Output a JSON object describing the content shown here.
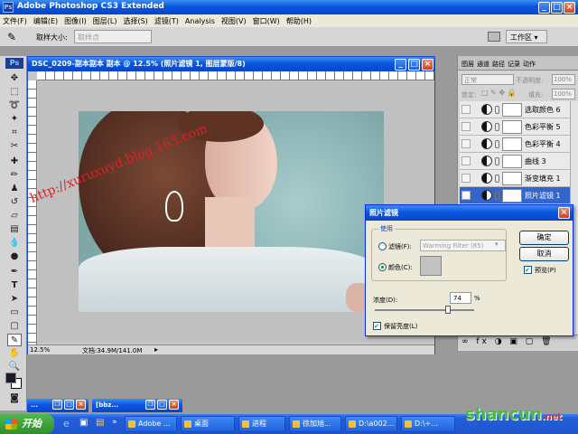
{
  "app": {
    "title": "Adobe Photoshop CS3 Extended"
  },
  "menu": [
    "文件(F)",
    "编辑(E)",
    "图像(I)",
    "图层(L)",
    "选择(S)",
    "滤镜(T)",
    "Analysis",
    "视图(V)",
    "窗口(W)",
    "帮助(H)"
  ],
  "options": {
    "sample_size_label": "取样大小:",
    "sample_size_value": "取样点",
    "workspace_label": "工作区"
  },
  "document": {
    "title": "DSC_0209-副本副本 副本 @ 12.5% (照片滤镜 1, 图层蒙版/8)",
    "zoom": "12.5%",
    "doc_size": "文档:34.9M/141.0M",
    "watermark": "http://xuruxuyd.blog.163.com"
  },
  "layers_panel": {
    "tabs": [
      "图层",
      "通道",
      "路径",
      "记录",
      "动作"
    ],
    "blend_mode": "正常",
    "opacity_label": "不透明度:",
    "opacity_value": "100%",
    "lock_label": "锁定:",
    "fill_label": "填充:",
    "fill_value": "100%",
    "layers": [
      {
        "name": "选取颜色 6"
      },
      {
        "name": "色彩平衡 5"
      },
      {
        "name": "色彩平衡 4"
      },
      {
        "name": "曲线 3"
      },
      {
        "name": "渐变填充 1"
      },
      {
        "name": "照片滤镜 1"
      }
    ]
  },
  "dialog": {
    "title": "照片滤镜",
    "group_label": "使用",
    "filter_label": "滤镜(F):",
    "filter_value": "Warming Filter (85)",
    "color_label": "颜色(C):",
    "density_label": "浓度(D):",
    "density_value": "74",
    "density_unit": "%",
    "density_level": 0.74,
    "preserve_label": "保留亮度(L)",
    "ok_label": "确定",
    "cancel_label": "取消",
    "preview_label": "预览(P)",
    "swatch_color": "#c2c2c2"
  },
  "taskbar": {
    "start_label": "开始",
    "items": [
      "Adobe ...",
      "桌面",
      "进程",
      "徐加旭...",
      "D:\\a002...",
      "D:\\÷..."
    ],
    "minimized": [
      "..."
    ]
  },
  "brand": {
    "text": "shancun",
    "suffix": ".net"
  }
}
